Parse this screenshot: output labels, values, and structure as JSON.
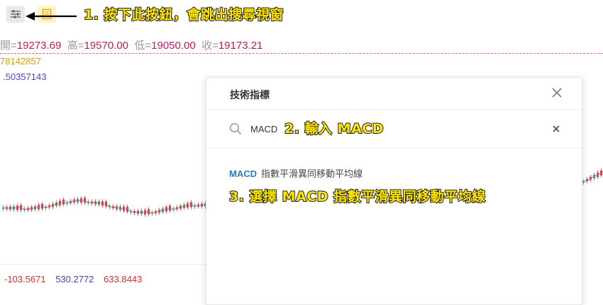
{
  "toolbar": {
    "indicator_icon": "sliders-icon",
    "template_icon": "document-icon"
  },
  "annotations": {
    "step1": "1. 按下此按鈕，會跳出搜尋視窗",
    "step2": "2. 輸入 MACD",
    "step3": "3. 選擇 MACD 指數平滑異同移動平均線"
  },
  "ohlc": {
    "open_label": "開=",
    "open_value": "19273.69",
    "high_label": "高=",
    "high_value": "19570.00",
    "low_label": "低=",
    "low_value": "19050.00",
    "close_label": "收=",
    "close_value": "19173.21"
  },
  "indicator_values": {
    "ma_yellow": "78142857",
    "ma_purple": ".50357143"
  },
  "macd_values": [
    {
      "value": "-103.5671",
      "color": "#d32f2f"
    },
    {
      "value": "530.2772",
      "color": "#3949ab"
    },
    {
      "value": "633.8443",
      "color": "#d32f2f"
    }
  ],
  "dialog": {
    "title": "技術指標",
    "search_value": "MACD",
    "search_placeholder": "",
    "results": [
      {
        "code": "MACD",
        "name": "指數平滑異同移動平均線"
      }
    ]
  },
  "colors": {
    "up_candle": "#e53935",
    "down_candle": "#43a047",
    "ma_line": "#9575cd",
    "accent": "#2a7db8",
    "annotation": "#ffe600"
  }
}
